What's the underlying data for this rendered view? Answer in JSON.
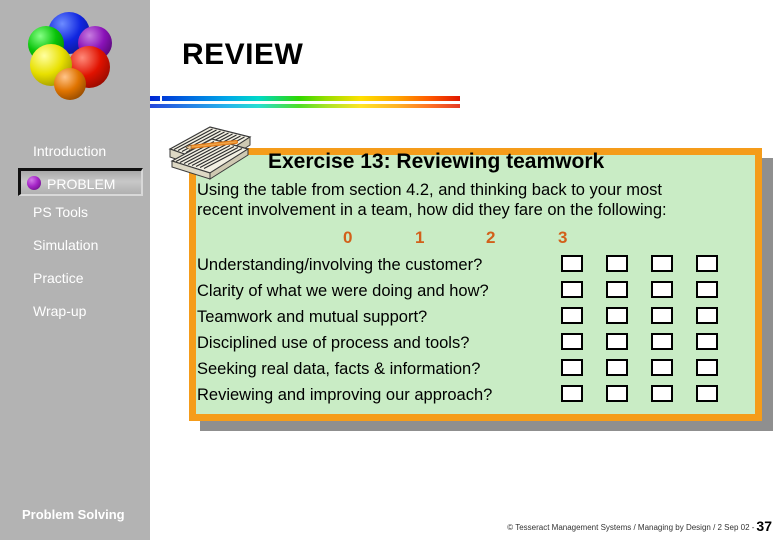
{
  "slide": {
    "title": "REVIEW",
    "section_label": "Problem Solving"
  },
  "sidebar": {
    "items": [
      {
        "label": "Introduction",
        "active": false
      },
      {
        "label": "PROBLEM",
        "active": true
      },
      {
        "label": "PS Tools",
        "active": false
      },
      {
        "label": "Simulation",
        "active": false
      },
      {
        "label": "Practice",
        "active": false
      },
      {
        "label": "Wrap-up",
        "active": false
      }
    ],
    "logo_icon": "colored-spheres-logo",
    "bullet_icon": "purple-sphere-bullet"
  },
  "content": {
    "notepad_icon": "notepad-pencil-icon",
    "exercise_title": "Exercise 13: Reviewing teamwork",
    "intro_line1": "Using the table from section 4.2, and thinking back to your most",
    "intro_line2": "recent involvement in a team, how did they fare on the following:",
    "scale": [
      "0",
      "1",
      "2",
      "3"
    ],
    "questions": [
      "Understanding/involving the customer?",
      "Clarity of what we were doing and how?",
      "Teamwork and mutual support?",
      "Disciplined use of process and tools?",
      "Seeking real data, facts & information?",
      "Reviewing and improving our approach?"
    ],
    "checkbox_state": "unchecked"
  },
  "footer": {
    "credit": "© Tesseract Management Systems / Managing by Design / 2 Sep 02  -",
    "page": "37"
  },
  "colors": {
    "sidebar_bg": "#b3b3b3",
    "content_bg": "#c9ecc5",
    "content_border": "#f59c1a",
    "scale_number": "#d2601a",
    "accent_bullet": "#a626c8"
  }
}
